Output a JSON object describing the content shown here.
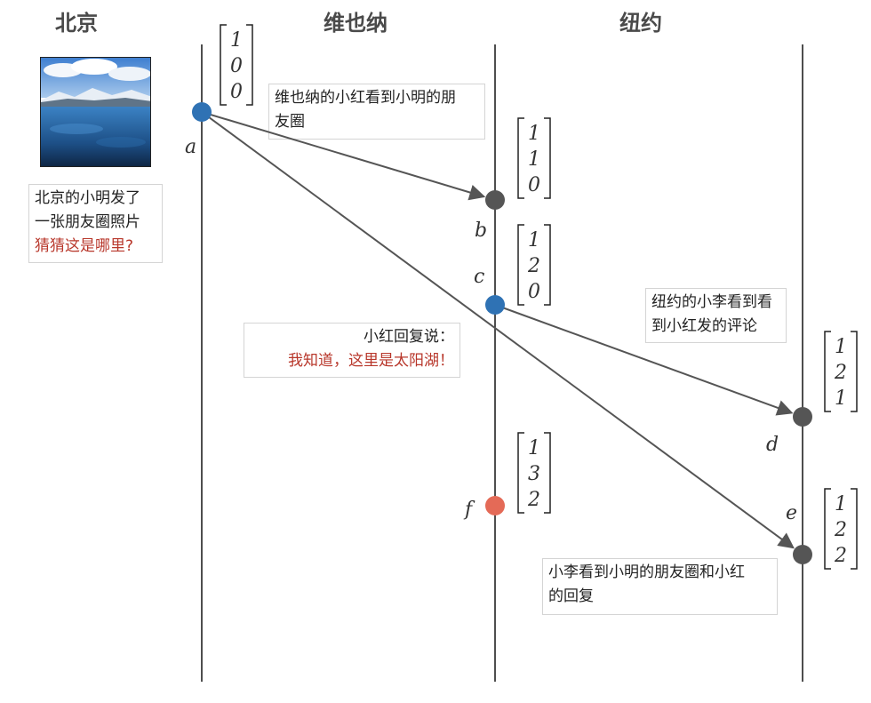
{
  "lanes": [
    {
      "id": "beijing",
      "title": "北京"
    },
    {
      "id": "vienna",
      "title": "维也纳"
    },
    {
      "id": "newyork",
      "title": "纽约"
    }
  ],
  "events": [
    {
      "id": "a",
      "label": "a",
      "lane": "beijing",
      "color": "#2f72b4",
      "vector": [
        "1",
        "0",
        "0"
      ]
    },
    {
      "id": "b",
      "label": "b",
      "lane": "vienna",
      "color": "#555555",
      "vector": [
        "1",
        "1",
        "0"
      ]
    },
    {
      "id": "c",
      "label": "c",
      "lane": "vienna",
      "color": "#2f72b4",
      "vector": [
        "1",
        "2",
        "0"
      ]
    },
    {
      "id": "d",
      "label": "d",
      "lane": "newyork",
      "color": "#555555",
      "vector": [
        "1",
        "2",
        "1"
      ]
    },
    {
      "id": "e",
      "label": "e",
      "lane": "newyork",
      "color": "#555555",
      "vector": [
        "1",
        "2",
        "2"
      ]
    },
    {
      "id": "f",
      "label": "f",
      "lane": "vienna",
      "color": "#e46a57",
      "vector": [
        "1",
        "3",
        "2"
      ]
    }
  ],
  "messages": [
    {
      "from": "a",
      "to": "b"
    },
    {
      "from": "a",
      "to": "e"
    },
    {
      "from": "c",
      "to": "d"
    }
  ],
  "notes": {
    "beijing_post": {
      "line1": "北京的小明发了",
      "line2": "一张朋友圈照片",
      "line3": "猜猜这是哪里?"
    },
    "vienna_sees": {
      "line1": "维也纳的小红看到小明的朋",
      "line2": "友圈"
    },
    "xiaohong_reply": {
      "line1": "小红回复说：",
      "line2": "我知道，这里是太阳湖！"
    },
    "newyork_sees": {
      "line1": "纽约的小李看到看",
      "line2": "到小红发的评论"
    },
    "xiaoli_sees_all": {
      "line1": "小李看到小明的朋友圈和小红",
      "line2": "的回复"
    }
  },
  "colors": {
    "line": "#222222",
    "arrow": "#555555",
    "highlight": "#b8372b"
  },
  "photo": {
    "icon": "lake-mountain-photo"
  }
}
